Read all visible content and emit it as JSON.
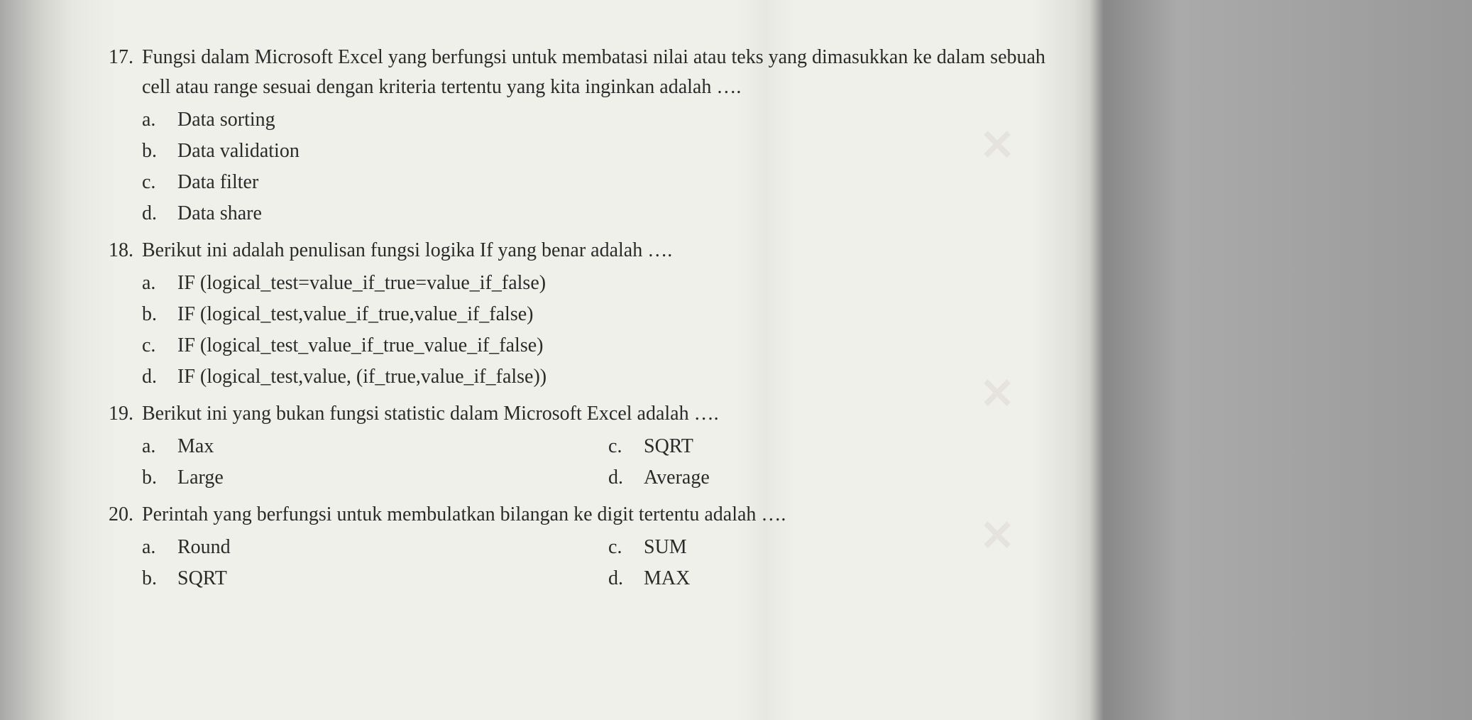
{
  "questions": [
    {
      "number": "17.",
      "text": "Fungsi dalam Microsoft Excel yang berfungsi untuk membatasi nilai atau teks yang dimasukkan ke dalam sebuah cell atau range sesuai dengan kriteria tertentu yang kita inginkan adalah ….",
      "layout": "single",
      "options": [
        {
          "letter": "a.",
          "text": "Data sorting"
        },
        {
          "letter": "b.",
          "text": "Data validation"
        },
        {
          "letter": "c.",
          "text": "Data filter"
        },
        {
          "letter": "d.",
          "text": "Data share"
        }
      ]
    },
    {
      "number": "18.",
      "text": "Berikut ini adalah penulisan fungsi logika If yang benar adalah ….",
      "layout": "single",
      "options": [
        {
          "letter": "a.",
          "text": "IF (logical_test=value_if_true=value_if_false)"
        },
        {
          "letter": "b.",
          "text": "IF (logical_test,value_if_true,value_if_false)"
        },
        {
          "letter": "c.",
          "text": "IF (logical_test_value_if_true_value_if_false)"
        },
        {
          "letter": "d.",
          "text": "IF (logical_test,value, (if_true,value_if_false))"
        }
      ]
    },
    {
      "number": "19.",
      "text": "Berikut ini yang bukan fungsi statistic dalam Microsoft Excel adalah ….",
      "layout": "two-col",
      "options_left": [
        {
          "letter": "a.",
          "text": "Max"
        },
        {
          "letter": "b.",
          "text": "Large"
        }
      ],
      "options_right": [
        {
          "letter": "c.",
          "text": "SQRT"
        },
        {
          "letter": "d.",
          "text": "Average"
        }
      ]
    },
    {
      "number": "20.",
      "text": "Perintah yang berfungsi untuk membulatkan bilangan ke digit tertentu adalah ….",
      "layout": "two-col",
      "options_left": [
        {
          "letter": "a.",
          "text": "Round"
        },
        {
          "letter": "b.",
          "text": "SQRT"
        }
      ],
      "options_right": [
        {
          "letter": "c.",
          "text": "SUM"
        },
        {
          "letter": "d.",
          "text": "MAX"
        }
      ]
    }
  ]
}
